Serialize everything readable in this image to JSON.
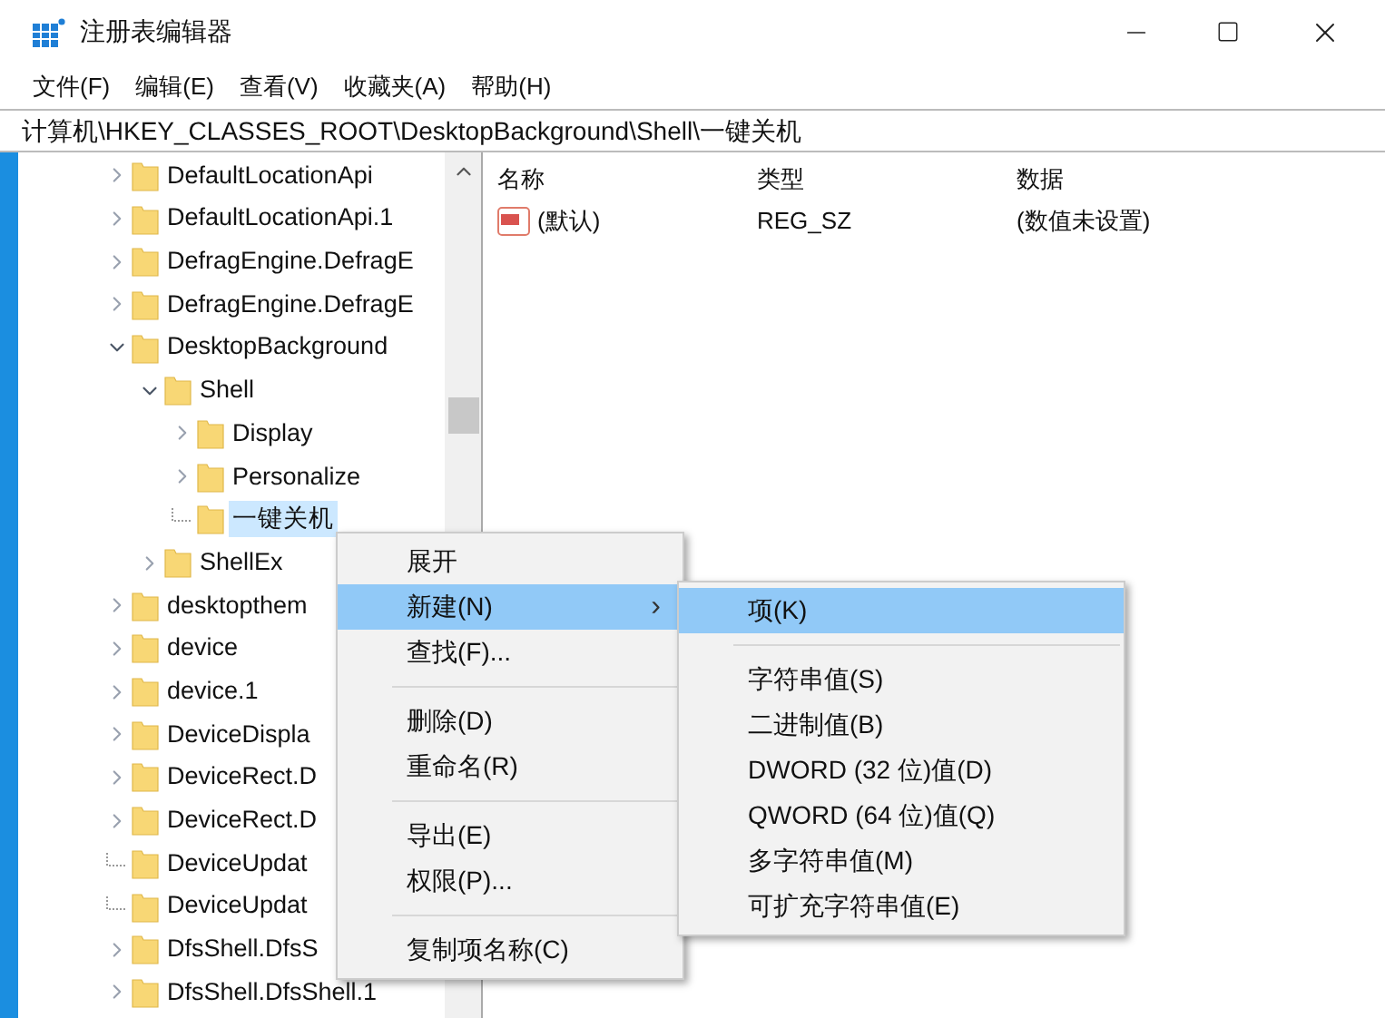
{
  "window": {
    "title": "注册表编辑器"
  },
  "menu_bar": [
    "文件(F)",
    "编辑(E)",
    "查看(V)",
    "收藏夹(A)",
    "帮助(H)"
  ],
  "address": "计算机\\HKEY_CLASSES_ROOT\\DesktopBackground\\Shell\\一键关机",
  "tree": [
    {
      "label": "DefaultLocationApi",
      "kind": "branch",
      "expanded": false,
      "selected": false
    },
    {
      "label": "DefaultLocationApi.1",
      "kind": "branch",
      "expanded": false,
      "selected": false
    },
    {
      "label": "DefragEngine.DefragE",
      "kind": "branch",
      "expanded": false,
      "selected": false
    },
    {
      "label": "DefragEngine.DefragE",
      "kind": "branch",
      "expanded": false,
      "selected": false
    },
    {
      "label": "DesktopBackground",
      "kind": "branch",
      "expanded": true,
      "selected": false,
      "children": [
        {
          "label": "Shell",
          "kind": "branch",
          "expanded": true,
          "selected": false,
          "children": [
            {
              "label": "Display",
              "kind": "branch",
              "expanded": false,
              "selected": false
            },
            {
              "label": "Personalize",
              "kind": "branch",
              "expanded": false,
              "selected": false
            },
            {
              "label": "一键关机",
              "kind": "leaf",
              "selected": true
            }
          ]
        },
        {
          "label": "ShellEx",
          "kind": "branch",
          "expanded": false,
          "selected": false
        }
      ]
    },
    {
      "label": "desktopthem",
      "kind": "branch",
      "expanded": false,
      "selected": false
    },
    {
      "label": "device",
      "kind": "branch",
      "expanded": false,
      "selected": false
    },
    {
      "label": "device.1",
      "kind": "branch",
      "expanded": false,
      "selected": false
    },
    {
      "label": "DeviceDispla",
      "kind": "branch",
      "expanded": false,
      "selected": false
    },
    {
      "label": "DeviceRect.D",
      "kind": "branch",
      "expanded": false,
      "selected": false
    },
    {
      "label": "DeviceRect.D",
      "kind": "branch",
      "expanded": false,
      "selected": false
    },
    {
      "label": "DeviceUpdat",
      "kind": "leaf",
      "selected": false
    },
    {
      "label": "DeviceUpdat",
      "kind": "leaf",
      "selected": false
    },
    {
      "label": "DfsShell.DfsS",
      "kind": "branch",
      "expanded": false,
      "selected": false
    },
    {
      "label": "DfsShell.DfsShell.1",
      "kind": "branch",
      "expanded": false,
      "selected": false
    }
  ],
  "table": {
    "columns": [
      "名称",
      "类型",
      "数据"
    ],
    "rows": [
      {
        "name": "(默认)",
        "type": "REG_SZ",
        "data": "(数值未设置)"
      }
    ]
  },
  "context_menu": [
    {
      "kind": "item",
      "label": "展开",
      "selected": false
    },
    {
      "kind": "submenu",
      "label": "新建(N)",
      "arrow": "›",
      "selected": true
    },
    {
      "kind": "item",
      "label": "查找(F)...",
      "selected": false
    },
    {
      "kind": "separator"
    },
    {
      "kind": "item",
      "label": "删除(D)",
      "selected": false
    },
    {
      "kind": "item",
      "label": "重命名(R)",
      "selected": false
    },
    {
      "kind": "separator"
    },
    {
      "kind": "item",
      "label": "导出(E)",
      "selected": false
    },
    {
      "kind": "item",
      "label": "权限(P)...",
      "selected": false
    },
    {
      "kind": "separator"
    },
    {
      "kind": "item",
      "label": "复制项名称(C)",
      "selected": false
    }
  ],
  "submenu": [
    {
      "kind": "item",
      "label": "项(K)",
      "selected": true
    },
    {
      "kind": "separator"
    },
    {
      "kind": "item",
      "label": "字符串值(S)",
      "selected": false
    },
    {
      "kind": "item",
      "label": "二进制值(B)",
      "selected": false
    },
    {
      "kind": "item",
      "label": "DWORD (32 位)值(D)",
      "selected": false
    },
    {
      "kind": "item",
      "label": "QWORD (64 位)值(Q)",
      "selected": false
    },
    {
      "kind": "item",
      "label": "多字符串值(M)",
      "selected": false
    },
    {
      "kind": "item",
      "label": "可扩充字符串值(E)",
      "selected": false
    }
  ]
}
